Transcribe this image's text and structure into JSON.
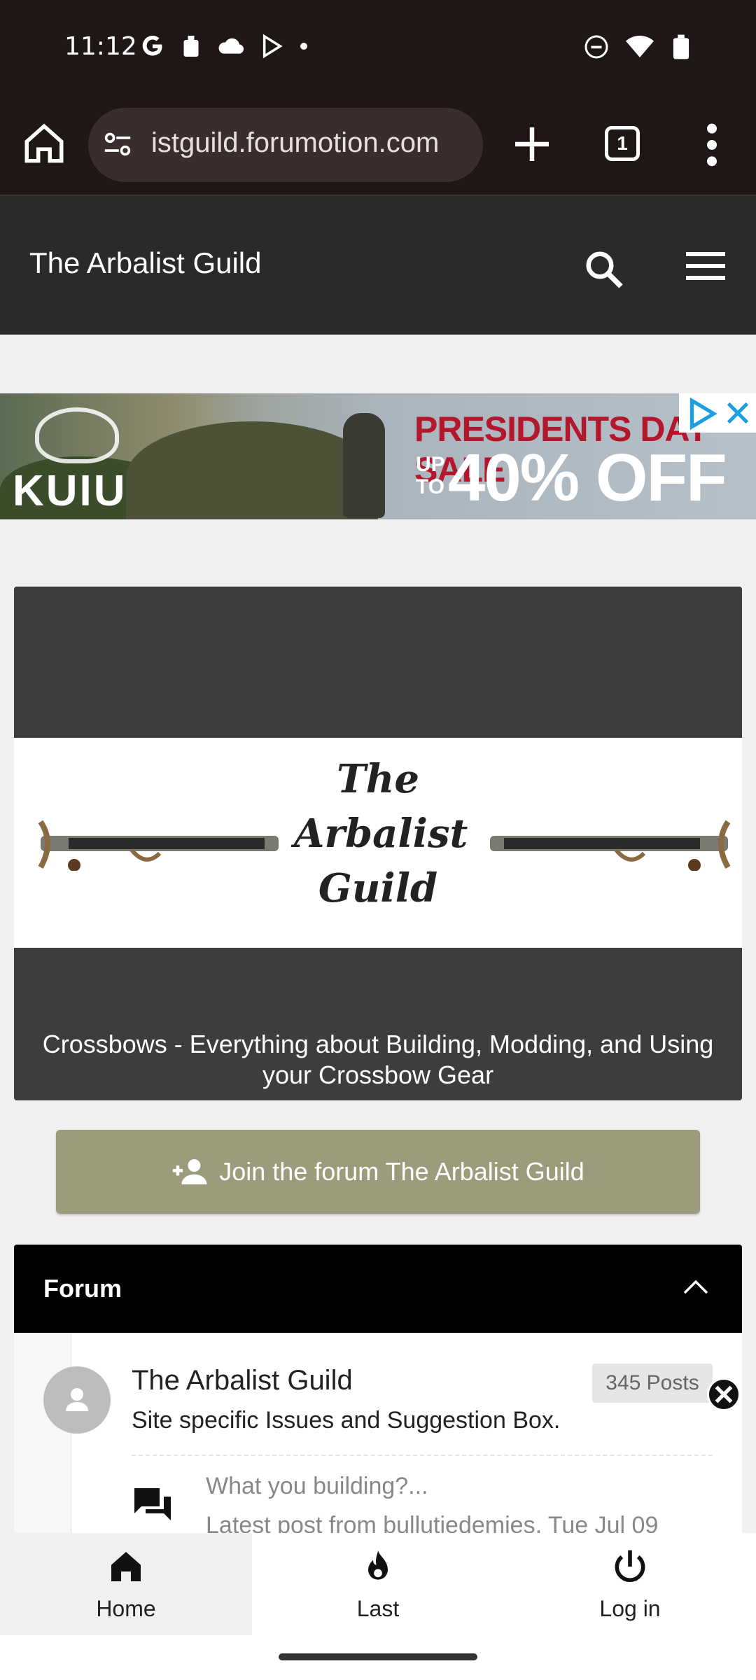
{
  "status_bar": {
    "time": "11:12"
  },
  "browser": {
    "url": "istguild.forumotion.com",
    "tab_count": "1"
  },
  "site": {
    "title": "The Arbalist Guild"
  },
  "ad": {
    "brand": "KUIU",
    "headline": "PRESIDENTS DAY SALE",
    "up_to": "UP TO",
    "offer": "40% OFF"
  },
  "hero": {
    "caption": "Crossbows - Everything about Building, Modding, and Using your Crossbow Gear",
    "logo_lines": [
      "The",
      "Arbalist",
      "Guild"
    ]
  },
  "join_button": {
    "label": "Join the forum The Arbalist Guild"
  },
  "forum": {
    "header": "Forum",
    "items": [
      {
        "name": "The Arbalist Guild",
        "description": "Site specific Issues and Suggestion Box.",
        "posts": "345 Posts",
        "subforum": "What you building?...",
        "latest": "Latest post from bullutiedemies, Tue Jul 09"
      }
    ]
  },
  "bottom_nav": {
    "items": [
      {
        "label": "Home",
        "icon": "home-icon",
        "active": true
      },
      {
        "label": "Last",
        "icon": "flame-icon",
        "active": false
      },
      {
        "label": "Log in",
        "icon": "power-icon",
        "active": false
      }
    ]
  },
  "colors": {
    "browser_chrome": "#1f1616",
    "site_header": "#2a2a2a",
    "join_button": "#9c9c7c",
    "forum_header": "#000000"
  }
}
